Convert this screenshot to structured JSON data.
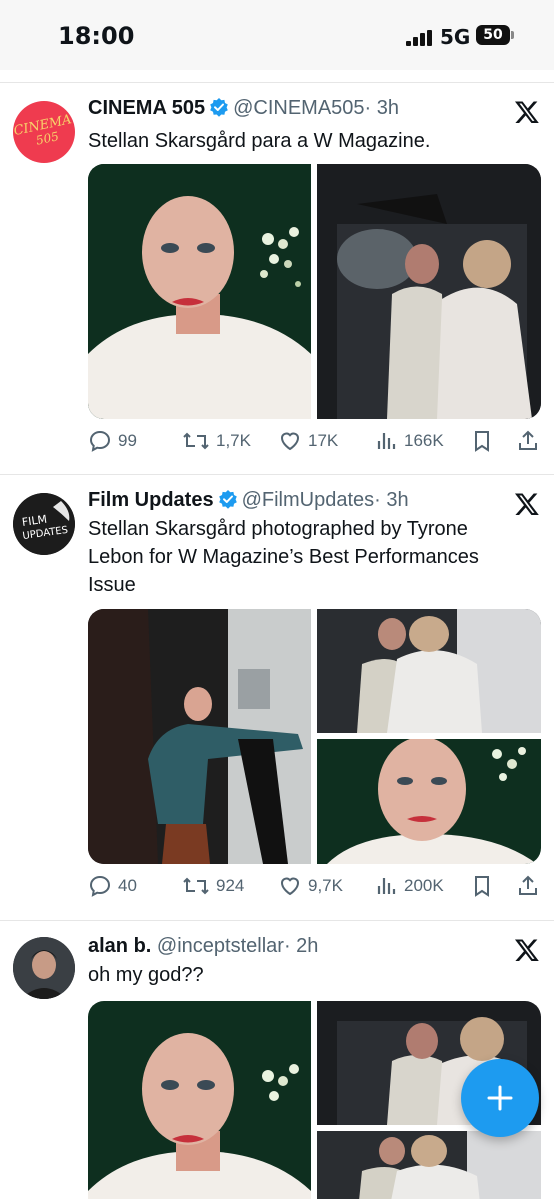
{
  "status": {
    "time": "18:00",
    "network": "5G",
    "battery": "50"
  },
  "tweets": [
    {
      "name": "CINEMA 505",
      "handle": "@CINEMA505",
      "time": "· 3h",
      "avatar_text": "CINEMA 505",
      "text": "Stellan Skarsgård para a W Magazine.",
      "replies": "99",
      "retweets": "1,7K",
      "likes": "17K",
      "views": "166K"
    },
    {
      "name": "Film Updates",
      "handle": "@FilmUpdates",
      "time": "· 3h",
      "avatar_text": "FILM UPDATES",
      "text": "Stellan Skarsgård photographed by Tyrone Lebon for W Magazine’s Best Performances Issue",
      "replies": "40",
      "retweets": "924",
      "likes": "9,7K",
      "views": "200K"
    },
    {
      "name": "alan b.",
      "handle": "@inceptstellar",
      "time": "· 2h",
      "text": "oh my god??"
    }
  ],
  "colors": {
    "accent": "#1d9bf0",
    "secondary_text": "#536471",
    "avatar_cinema": "#ef3b4f"
  },
  "icons": [
    "signal-icon",
    "verified-badge-icon",
    "x-logo-icon",
    "reply-icon",
    "retweet-icon",
    "like-icon",
    "views-icon",
    "bookmark-icon",
    "share-icon",
    "compose-plus-icon"
  ]
}
